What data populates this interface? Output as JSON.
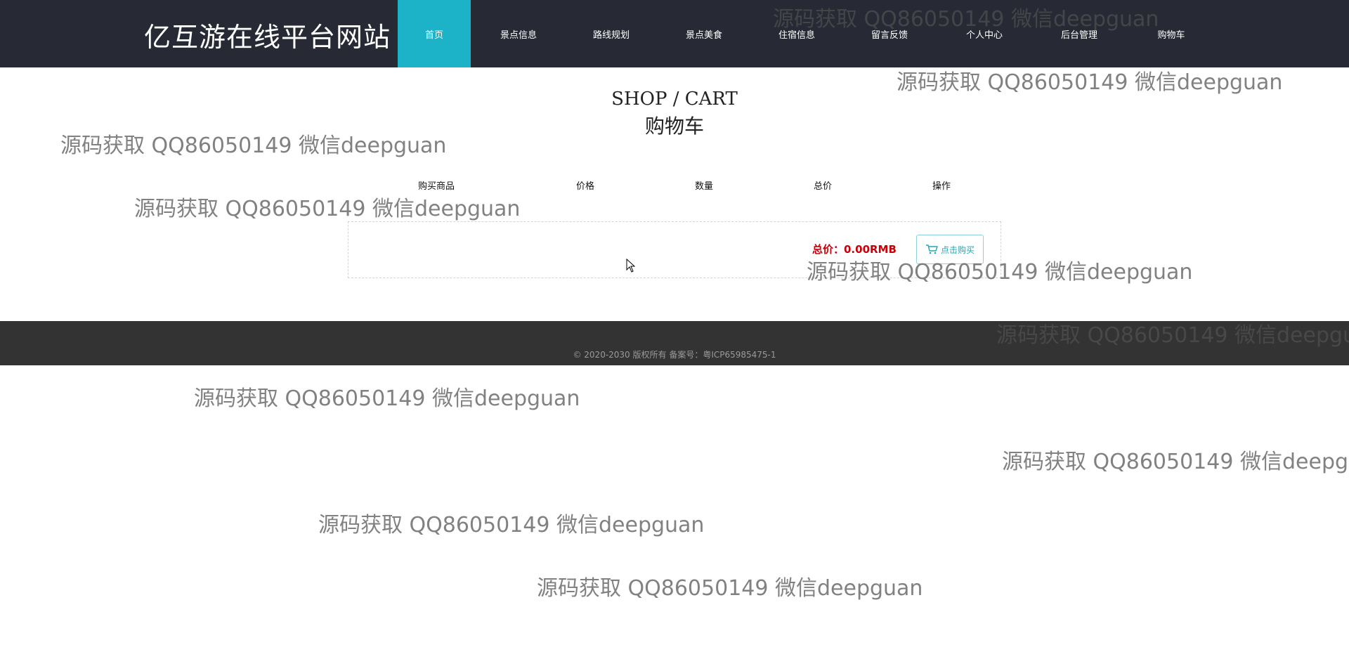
{
  "header": {
    "site_title": "亿互游在线平台网站",
    "nav": [
      {
        "label": "首页",
        "active": true
      },
      {
        "label": "景点信息",
        "active": false
      },
      {
        "label": "路线规划",
        "active": false
      },
      {
        "label": "景点美食",
        "active": false
      },
      {
        "label": "住宿信息",
        "active": false
      },
      {
        "label": "留言反馈",
        "active": false
      },
      {
        "label": "个人中心",
        "active": false
      },
      {
        "label": "后台管理",
        "active": false
      },
      {
        "label": "购物车",
        "active": false
      }
    ]
  },
  "cart": {
    "title_en": "SHOP / CART",
    "title_zh": "购物车",
    "columns": [
      "购买商品",
      "价格",
      "数量",
      "总价",
      "操作"
    ],
    "total_text": "总价：0.00RMB",
    "buy_button_label": "点击购买",
    "buy_button_icon": "shopping-cart-icon"
  },
  "footer": {
    "copyright": "© 2020-2030 版权所有 备案号：粤ICP65985475-1"
  },
  "watermark": {
    "text": "源码获取 QQ86050149 微信deepguan"
  },
  "colors": {
    "header_bg": "#272a35",
    "nav_active_bg": "#1cb3c8",
    "footer_bg": "#333333",
    "total_price": "#c8000a",
    "buy_button_text": "#1ea6b8"
  }
}
